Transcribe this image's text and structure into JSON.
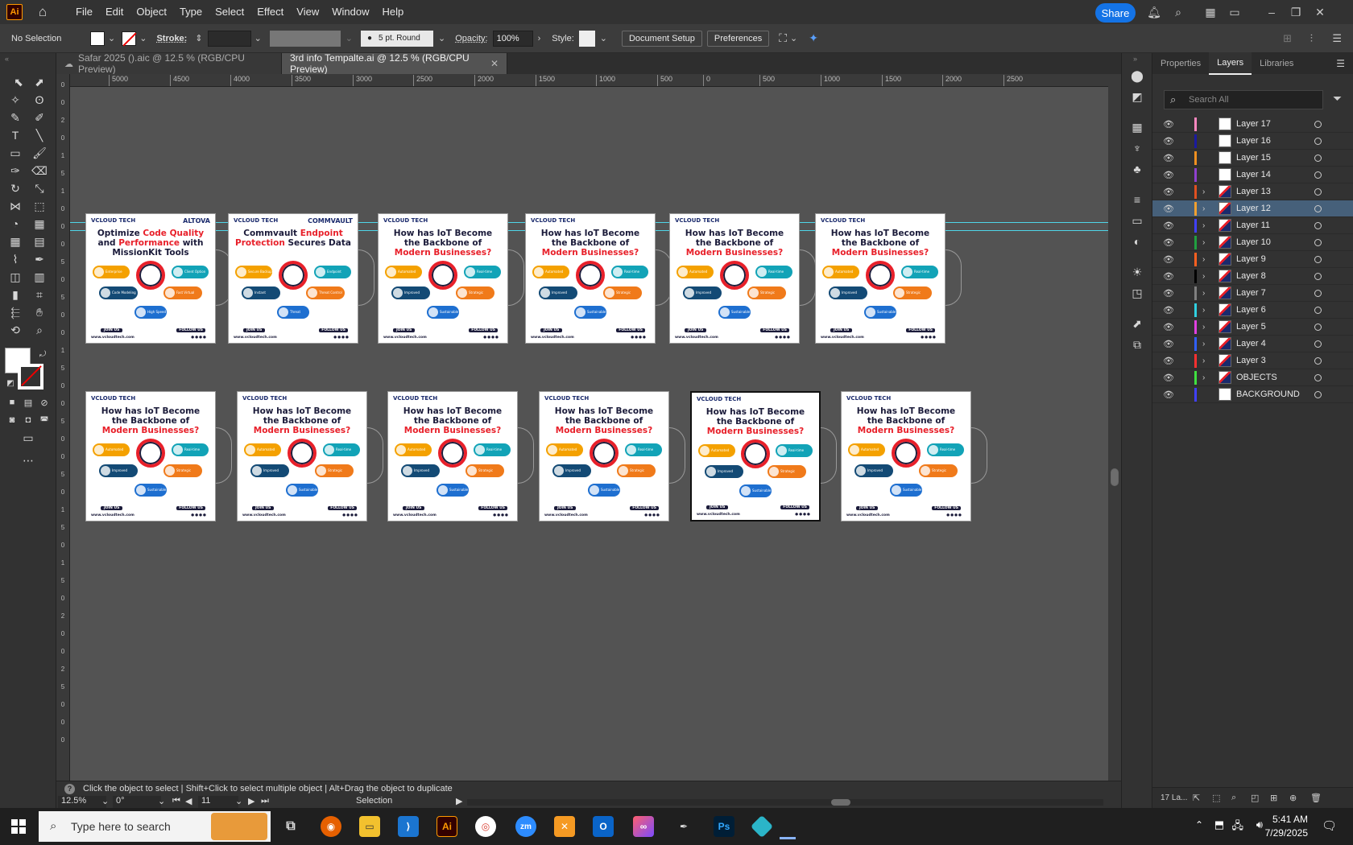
{
  "menubar": {
    "logo": "Ai",
    "menus": [
      "File",
      "Edit",
      "Object",
      "Type",
      "Select",
      "Effect",
      "View",
      "Window",
      "Help"
    ],
    "share": "Share"
  },
  "control": {
    "selection": "No Selection",
    "stroke_label": "Stroke:",
    "brush": "5 pt. Round",
    "opacity_label": "Opacity:",
    "opacity": "100%",
    "style_label": "Style:",
    "doc_setup": "Document Setup",
    "preferences": "Preferences"
  },
  "tabs": [
    {
      "label": "Safar 2025 ().aic @ 12.5 % (RGB/CPU Preview)"
    },
    {
      "label": "3rd info Tempalte.ai @ 12.5 % (RGB/CPU Preview)"
    }
  ],
  "ruler": {
    "h": [
      "5000",
      "4500",
      "4000",
      "3500",
      "3000",
      "2500",
      "2000",
      "1500",
      "1000",
      "500",
      "0",
      "500",
      "1000",
      "1500",
      "2000",
      "2500"
    ],
    "v": [
      "0",
      "0",
      "2",
      "0",
      "1",
      "5",
      "1",
      "0",
      "0",
      "0",
      "5",
      "0",
      "5",
      "0",
      "0",
      "1",
      "5",
      "0",
      "0",
      "5",
      "0",
      "0",
      "5",
      "0",
      "1",
      "5",
      "0",
      "1",
      "5",
      "0",
      "2",
      "0",
      "0",
      "2",
      "5",
      "0",
      "0",
      "0"
    ]
  },
  "panel": {
    "tabs": [
      "Properties",
      "Layers",
      "Libraries"
    ],
    "search": "Search All",
    "layers": [
      {
        "name": "Layer 17",
        "color": "#ff88c0",
        "expand": false,
        "thumb": false
      },
      {
        "name": "Layer 16",
        "color": "#1a1aa0",
        "expand": false,
        "thumb": false
      },
      {
        "name": "Layer 15",
        "color": "#f09020",
        "expand": false,
        "thumb": false
      },
      {
        "name": "Layer 14",
        "color": "#9040d0",
        "expand": false,
        "thumb": false
      },
      {
        "name": "Layer 13",
        "color": "#e05020",
        "expand": true,
        "thumb": true
      },
      {
        "name": "Layer 12",
        "color": "#f0a030",
        "expand": true,
        "thumb": true
      },
      {
        "name": "Layer 11",
        "color": "#4040ff",
        "expand": true,
        "thumb": true
      },
      {
        "name": "Layer 10",
        "color": "#20a040",
        "expand": true,
        "thumb": true
      },
      {
        "name": "Layer 9",
        "color": "#ff6020",
        "expand": true,
        "thumb": true
      },
      {
        "name": "Layer 8",
        "color": "#000000",
        "expand": true,
        "thumb": true
      },
      {
        "name": "Layer 7",
        "color": "#808080",
        "expand": true,
        "thumb": true
      },
      {
        "name": "Layer 6",
        "color": "#30d0e0",
        "expand": true,
        "thumb": true
      },
      {
        "name": "Layer 5",
        "color": "#e040e0",
        "expand": true,
        "thumb": true
      },
      {
        "name": "Layer 4",
        "color": "#3060ff",
        "expand": true,
        "thumb": true
      },
      {
        "name": "Layer 3",
        "color": "#ff3030",
        "expand": true,
        "thumb": true
      },
      {
        "name": "OBJECTS",
        "color": "#40e040",
        "expand": true,
        "thumb": true
      },
      {
        "name": "BACKGROUND",
        "color": "#4040ff",
        "expand": false,
        "thumb": false
      }
    ],
    "selected_layer": "Layer 12",
    "footer": "17 La..."
  },
  "status": {
    "hint": "Click the object to select  |  Shift+Click to select multiple object  |  Alt+Drag the object to duplicate",
    "zoom": "12.5%",
    "rotation": "0°",
    "artboard": "11",
    "tool": "Selection"
  },
  "artboards": {
    "brand": "VCLOUD TECH",
    "join": "JOIN US",
    "follow": "FOLLOW US",
    "web": "www.vcloudtech.com",
    "a1": {
      "partner": "ALTOVA",
      "t1": "Optimize ",
      "t2": "Code Quality",
      "t3": " and ",
      "t4": "Performance",
      "t5": " with MissionKit Tools",
      "pills": [
        "Enterprise Apps",
        "Client Option Engine",
        "Code Modeling Functions",
        "Fast Virtual Tools",
        "High Speed Performance"
      ]
    },
    "a2": {
      "partner": "COMMVAULT",
      "t1": "Commvault ",
      "t2": "Endpoint Protection",
      "t3": " Secures Data",
      "pills": [
        "Secure Backup",
        "Endpoint Safety",
        "Instant Recovery",
        "Threat Control",
        "Threat Defense"
      ]
    },
    "iot": {
      "t1": "How has IoT Become the Backbone of ",
      "t2": "Modern Businesses?",
      "pills": [
        "Automated Efficiency",
        "Real-time Support",
        "Improved Experience",
        "Strategic Analytics",
        "Sustainable Usage"
      ]
    }
  },
  "taskbar": {
    "search": "Type here to search",
    "time": "5:41 AM",
    "date": "7/29/2025"
  }
}
